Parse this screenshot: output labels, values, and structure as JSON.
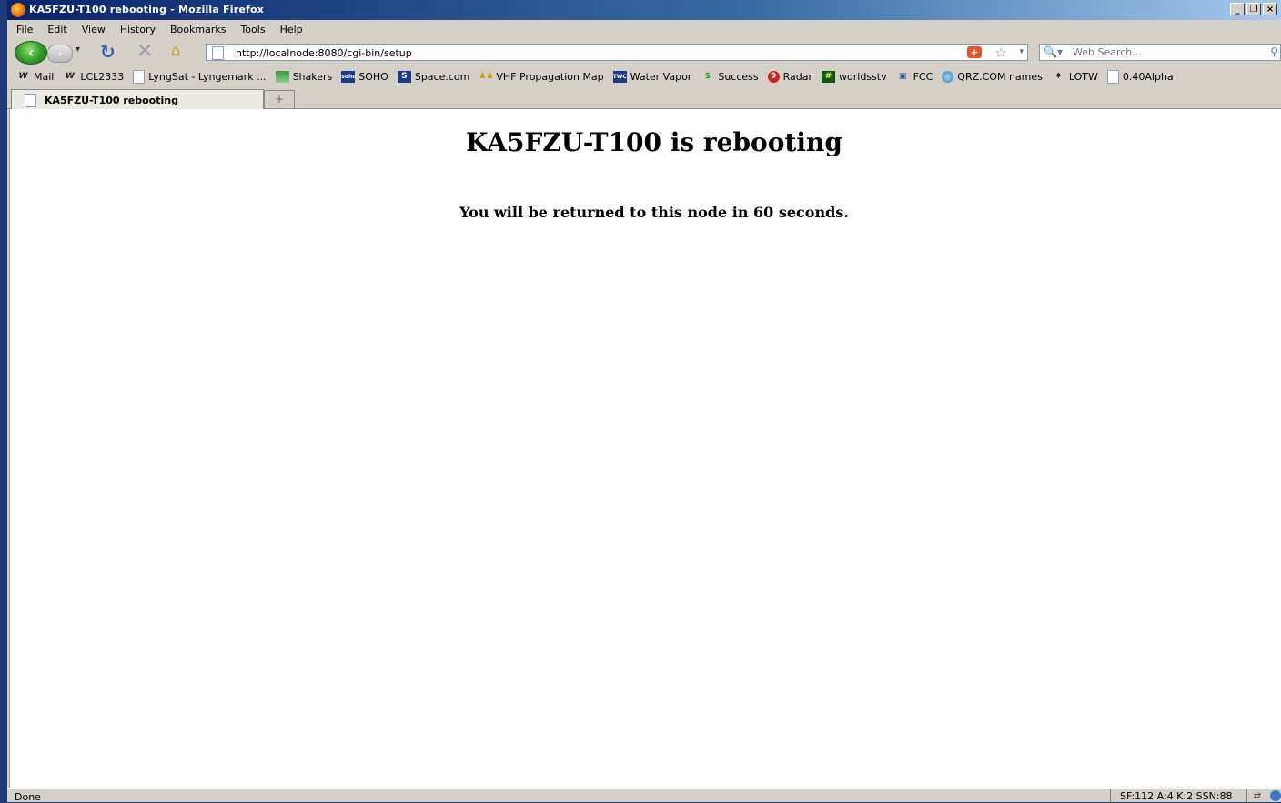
{
  "window": {
    "title": "KA5FZU-T100 rebooting - Mozilla Firefox"
  },
  "menu": [
    "File",
    "Edit",
    "View",
    "History",
    "Bookmarks",
    "Tools",
    "Help"
  ],
  "nav": {
    "url": "http://localnode:8080/cgi-bin/setup",
    "search_placeholder": "Web Search..."
  },
  "bookmarks": [
    {
      "label": "Mail",
      "icon": "W"
    },
    {
      "label": "LCL2333",
      "icon": "W"
    },
    {
      "label": "LyngSat - Lyngemark ...",
      "icon": "doc"
    },
    {
      "label": "Shakers",
      "icon": "green-wave"
    },
    {
      "label": "SOHO",
      "icon": "soho"
    },
    {
      "label": "Space.com",
      "icon": "S"
    },
    {
      "label": "VHF Propagation Map",
      "icon": "walkers"
    },
    {
      "label": "Water Vapor",
      "icon": "TWC"
    },
    {
      "label": "Success",
      "icon": "dollar"
    },
    {
      "label": "Radar",
      "icon": "red-circle"
    },
    {
      "label": "worldsstv",
      "icon": "dark-green"
    },
    {
      "label": "FCC",
      "icon": "fcc"
    },
    {
      "label": "QRZ.COM names",
      "icon": "globe"
    },
    {
      "label": "LOTW",
      "icon": "diamond"
    },
    {
      "label": "0.40Alpha",
      "icon": "doc"
    }
  ],
  "tab": {
    "label": "KA5FZU-T100 rebooting"
  },
  "page": {
    "heading": "KA5FZU-T100 is rebooting",
    "message": "You will be returned to this node in 60 seconds."
  },
  "status": {
    "text": "Done",
    "info": "SF:112 A:4 K:2 SSN:88"
  },
  "colors": {
    "title_bar": "#0a246a",
    "chrome": "#d4d0c8",
    "desktop": "#1c3a78"
  }
}
